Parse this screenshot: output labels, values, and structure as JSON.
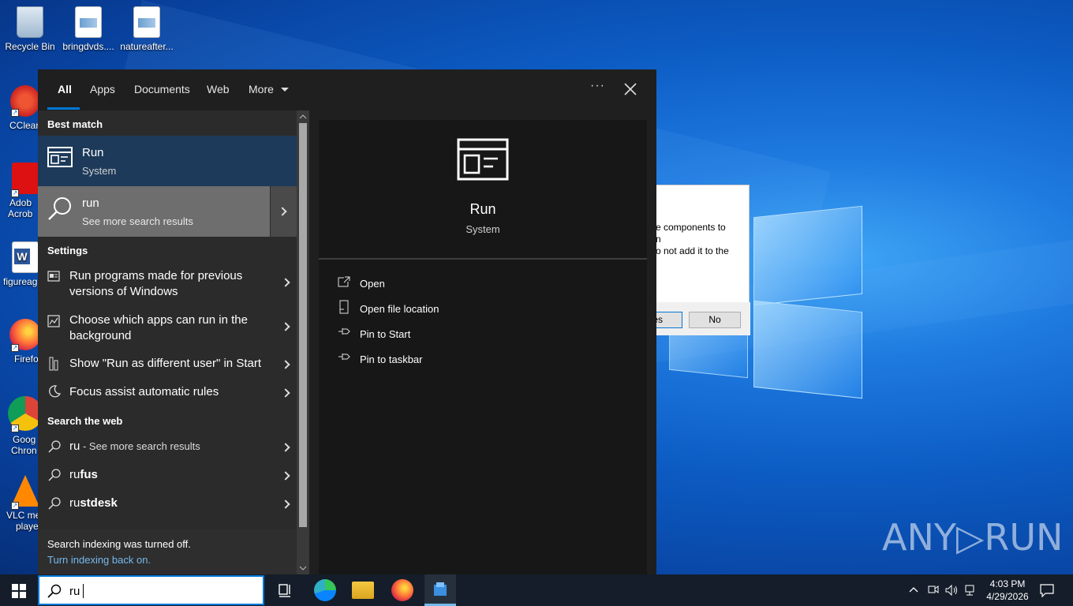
{
  "desktop": {
    "icons": [
      {
        "label": "Recycle Bin",
        "icon": "recycle-bin-icon"
      },
      {
        "label": "bringdvds....",
        "icon": "image-file-icon"
      },
      {
        "label": "natureafter...",
        "icon": "image-file-icon"
      },
      {
        "label": "CClean",
        "icon": "ccleaner-icon"
      },
      {
        "label": "Adob",
        "label2": "Acrob",
        "icon": "acrobat-icon"
      },
      {
        "label": "figureag",
        "icon": "word-doc-icon"
      },
      {
        "label": "Firefo",
        "icon": "firefox-icon"
      },
      {
        "label": "Goog",
        "label2": "Chron",
        "icon": "chrome-icon"
      },
      {
        "label": "VLC me",
        "label2": "playe",
        "icon": "vlc-icon"
      }
    ],
    "bg_dialog": {
      "text_line1": "e components to",
      "text_line2": "n",
      "text_line3": "o not add it to the",
      "yes_fragment": "es",
      "no_label": "No"
    },
    "watermark": "ANY▷RUN"
  },
  "search_panel": {
    "tabs": [
      {
        "label": "All",
        "active": true
      },
      {
        "label": "Apps"
      },
      {
        "label": "Documents"
      },
      {
        "label": "Web"
      },
      {
        "label": "More"
      }
    ],
    "more_options": "···",
    "best_match_header": "Best match",
    "best_match": {
      "title": "Run",
      "subtitle": "System"
    },
    "search_more": {
      "title": "run",
      "subtitle": "See more search results"
    },
    "settings_header": "Settings",
    "settings": [
      {
        "line1": "Run programs made for previous",
        "line2": "versions of Windows"
      },
      {
        "line1": "Choose which apps can run in the",
        "line2": "background"
      },
      {
        "line1": "Show \"Run as different user\" in Start"
      },
      {
        "line1": "Focus assist automatic rules"
      }
    ],
    "web_header": "Search the web",
    "web_results": [
      {
        "prefix": "ru",
        "bold": "",
        "suffix": " - See more search results"
      },
      {
        "prefix": "ru",
        "bold": "fus",
        "suffix": ""
      },
      {
        "prefix": "ru",
        "bold": "stdesk",
        "suffix": ""
      }
    ],
    "index_note": "Search indexing was turned off.",
    "index_link": "Turn indexing back on.",
    "detail": {
      "title": "Run",
      "subtitle": "System",
      "actions": [
        "Open",
        "Open file location",
        "Pin to Start",
        "Pin to taskbar"
      ]
    }
  },
  "taskbar": {
    "search_value": "ru",
    "time": "4:03 PM",
    "date": "4/29/2026"
  },
  "colors": {
    "accent": "#0078d7",
    "panel_bg": "#1f1f1f",
    "list_bg": "#2b2b2b",
    "selected_bg": "#1d3a5a",
    "hover_bg": "#6e6e6e",
    "taskbar_bg": "#141d29"
  }
}
